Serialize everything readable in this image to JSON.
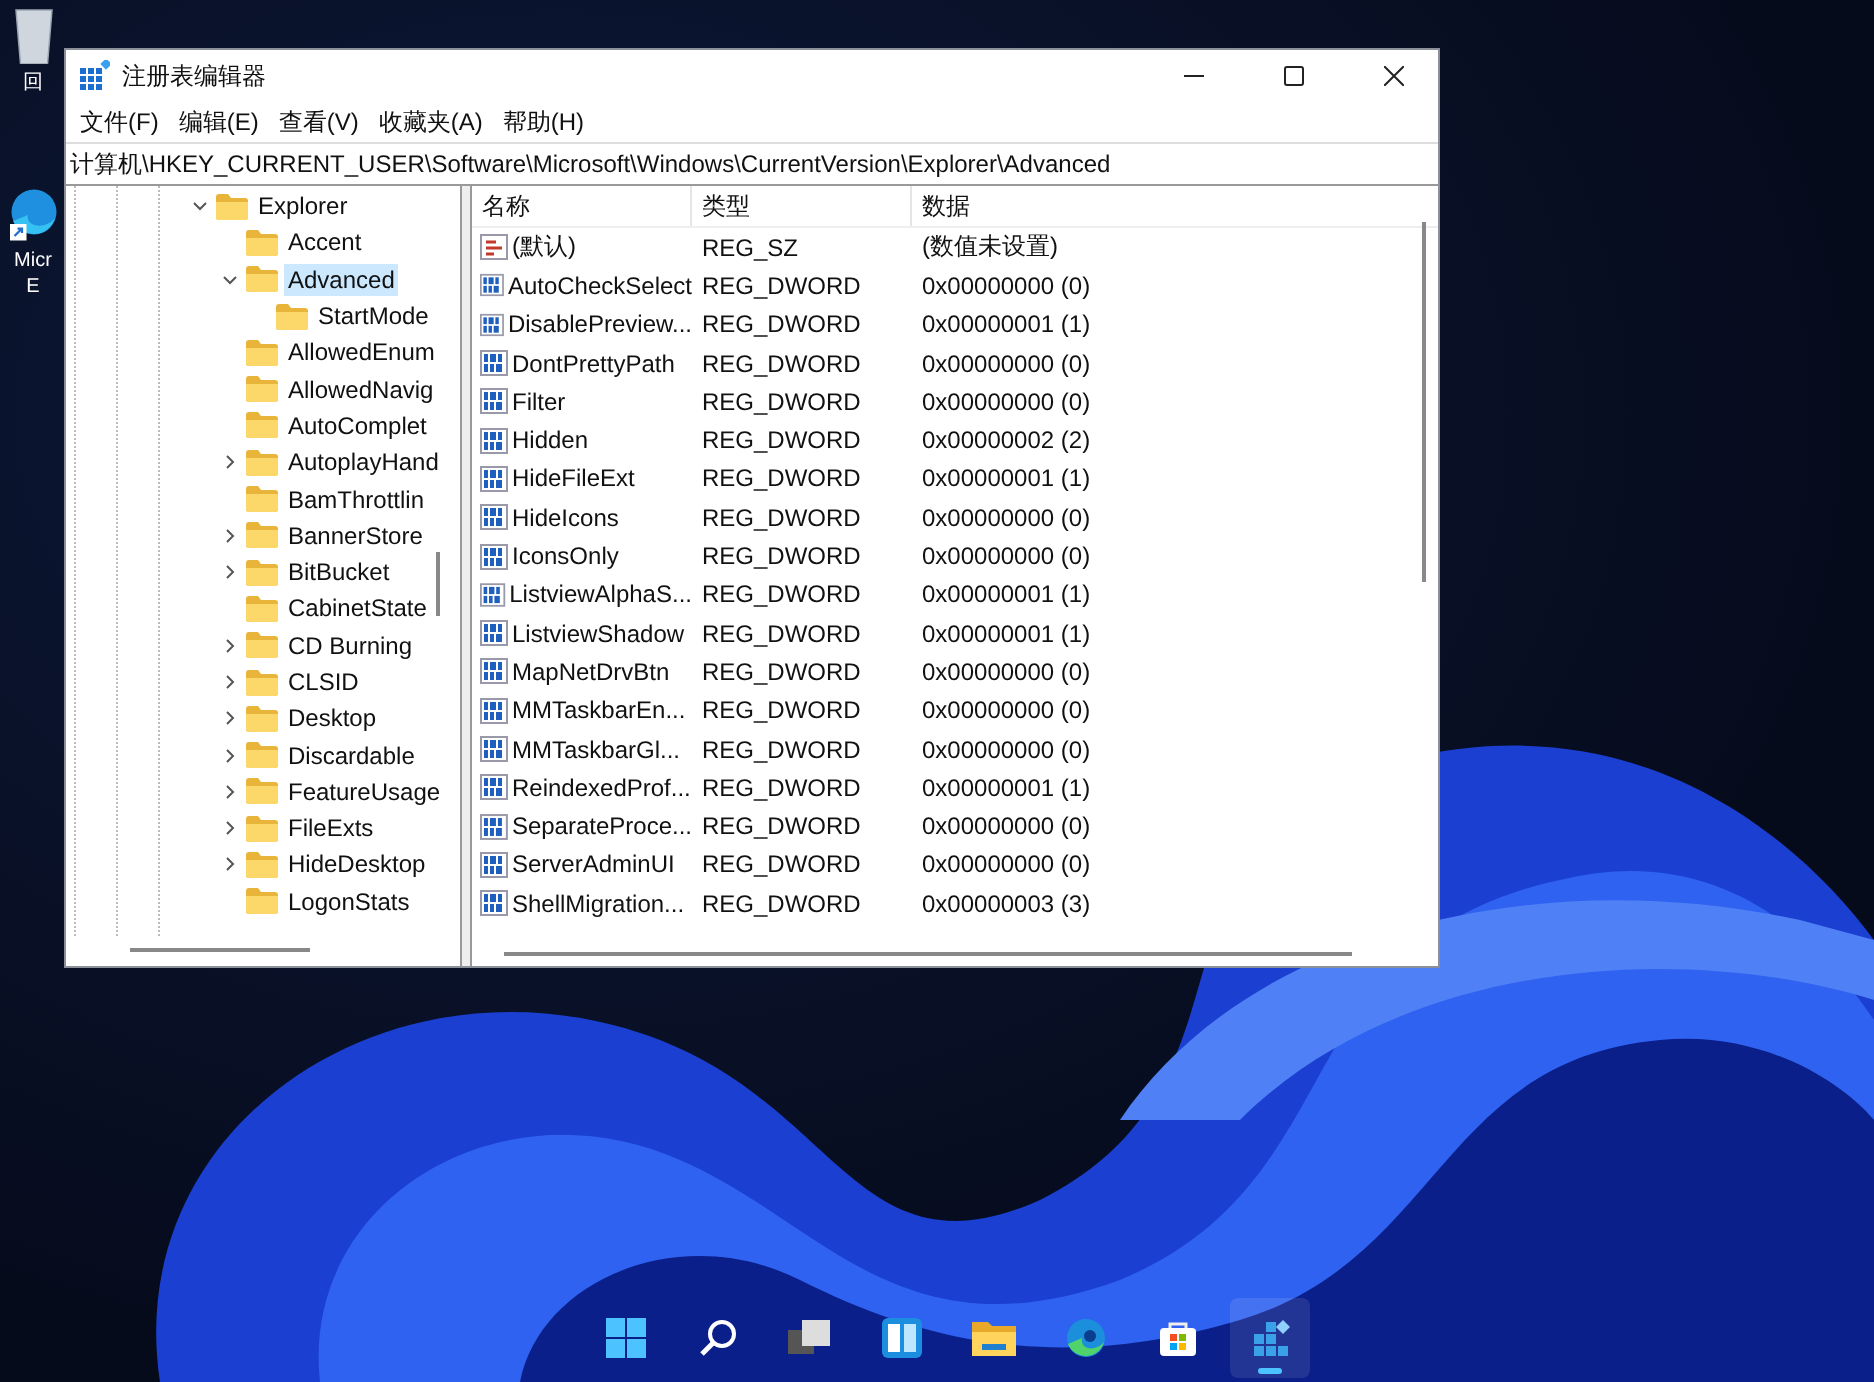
{
  "desktop": {
    "icons": [
      {
        "kind": "recycle",
        "lines": [
          "回"
        ]
      },
      {
        "kind": "edge",
        "lines": [
          "Micr",
          "E"
        ]
      }
    ]
  },
  "window": {
    "title": "注册表编辑器",
    "menu": [
      "文件(F)",
      "编辑(E)",
      "查看(V)",
      "收藏夹(A)",
      "帮助(H)"
    ],
    "address": "计算机\\HKEY_CURRENT_USER\\Software\\Microsoft\\Windows\\CurrentVersion\\Explorer\\Advanced"
  },
  "tree": [
    {
      "label": "Explorer",
      "kind": "branch",
      "expanded": true,
      "selected": false,
      "children": [
        {
          "label": "Accent",
          "kind": "leaf",
          "selected": false
        },
        {
          "label": "Advanced",
          "kind": "branch",
          "expanded": true,
          "selected": true,
          "children": [
            {
              "label": "StartMode",
              "kind": "leaf",
              "selected": false
            }
          ]
        },
        {
          "label": "AllowedEnum",
          "kind": "leaf",
          "selected": false
        },
        {
          "label": "AllowedNavig",
          "kind": "leaf",
          "selected": false
        },
        {
          "label": "AutoComplet",
          "kind": "leaf",
          "selected": false
        },
        {
          "label": "AutoplayHand",
          "kind": "branch",
          "expanded": false,
          "selected": false
        },
        {
          "label": "BamThrottlin",
          "kind": "leaf",
          "selected": false
        },
        {
          "label": "BannerStore",
          "kind": "branch",
          "expanded": false,
          "selected": false
        },
        {
          "label": "BitBucket",
          "kind": "branch",
          "expanded": false,
          "selected": false
        },
        {
          "label": "CabinetState",
          "kind": "leaf",
          "selected": false
        },
        {
          "label": "CD Burning",
          "kind": "branch",
          "expanded": false,
          "selected": false
        },
        {
          "label": "CLSID",
          "kind": "branch",
          "expanded": false,
          "selected": false
        },
        {
          "label": "Desktop",
          "kind": "branch",
          "expanded": false,
          "selected": false
        },
        {
          "label": "Discardable",
          "kind": "branch",
          "expanded": false,
          "selected": false
        },
        {
          "label": "FeatureUsage",
          "kind": "branch",
          "expanded": false,
          "selected": false
        },
        {
          "label": "FileExts",
          "kind": "branch",
          "expanded": false,
          "selected": false
        },
        {
          "label": "HideDesktop",
          "kind": "branch",
          "expanded": false,
          "selected": false
        },
        {
          "label": "LogonStats",
          "kind": "leaf",
          "selected": false
        }
      ]
    }
  ],
  "table": {
    "columns": [
      "名称",
      "类型",
      "数据"
    ],
    "rows": [
      {
        "kind": "string",
        "name": "(默认)",
        "type": "REG_SZ",
        "data": "(数值未设置)"
      },
      {
        "kind": "dword",
        "name": "AutoCheckSelect",
        "type": "REG_DWORD",
        "data": "0x00000000 (0)"
      },
      {
        "kind": "dword",
        "name": "DisablePreview...",
        "type": "REG_DWORD",
        "data": "0x00000001 (1)"
      },
      {
        "kind": "dword",
        "name": "DontPrettyPath",
        "type": "REG_DWORD",
        "data": "0x00000000 (0)"
      },
      {
        "kind": "dword",
        "name": "Filter",
        "type": "REG_DWORD",
        "data": "0x00000000 (0)"
      },
      {
        "kind": "dword",
        "name": "Hidden",
        "type": "REG_DWORD",
        "data": "0x00000002 (2)"
      },
      {
        "kind": "dword",
        "name": "HideFileExt",
        "type": "REG_DWORD",
        "data": "0x00000001 (1)"
      },
      {
        "kind": "dword",
        "name": "HideIcons",
        "type": "REG_DWORD",
        "data": "0x00000000 (0)"
      },
      {
        "kind": "dword",
        "name": "IconsOnly",
        "type": "REG_DWORD",
        "data": "0x00000000 (0)"
      },
      {
        "kind": "dword",
        "name": "ListviewAlphaS...",
        "type": "REG_DWORD",
        "data": "0x00000001 (1)"
      },
      {
        "kind": "dword",
        "name": "ListviewShadow",
        "type": "REG_DWORD",
        "data": "0x00000001 (1)"
      },
      {
        "kind": "dword",
        "name": "MapNetDrvBtn",
        "type": "REG_DWORD",
        "data": "0x00000000 (0)"
      },
      {
        "kind": "dword",
        "name": "MMTaskbarEn...",
        "type": "REG_DWORD",
        "data": "0x00000000 (0)"
      },
      {
        "kind": "dword",
        "name": "MMTaskbarGl...",
        "type": "REG_DWORD",
        "data": "0x00000000 (0)"
      },
      {
        "kind": "dword",
        "name": "ReindexedProf...",
        "type": "REG_DWORD",
        "data": "0x00000001 (1)"
      },
      {
        "kind": "dword",
        "name": "SeparateProce...",
        "type": "REG_DWORD",
        "data": "0x00000000 (0)"
      },
      {
        "kind": "dword",
        "name": "ServerAdminUI",
        "type": "REG_DWORD",
        "data": "0x00000000 (0)"
      },
      {
        "kind": "dword",
        "name": "ShellMigration...",
        "type": "REG_DWORD",
        "data": "0x00000003 (3)"
      }
    ]
  },
  "taskbar": {
    "apps": [
      {
        "kind": "start",
        "selected": false
      },
      {
        "kind": "search",
        "selected": false
      },
      {
        "kind": "taskview",
        "selected": false
      },
      {
        "kind": "widgets",
        "selected": false
      },
      {
        "kind": "explorer",
        "selected": false
      },
      {
        "kind": "edge",
        "selected": false
      },
      {
        "kind": "store",
        "selected": false
      },
      {
        "kind": "regedit",
        "selected": true
      }
    ]
  }
}
